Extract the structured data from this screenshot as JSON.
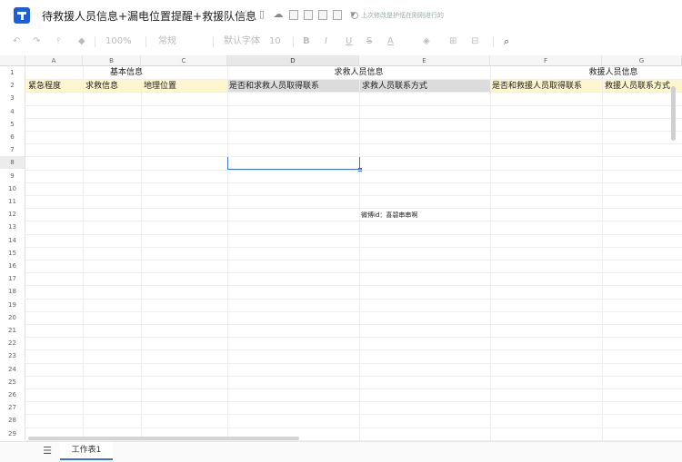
{
  "window": {
    "title": "待救援人员信息+漏电位置提醒+救援队信息",
    "save_status": "上次修改是护恬在刚刚进行的"
  },
  "title_icons": [
    "star-icon",
    "doc-icon",
    "cloud-icon",
    "box-icon",
    "box-icon",
    "box-icon",
    "box-icon",
    "chevron-down-icon"
  ],
  "toolbar": {
    "undo": "↶",
    "redo": "↷",
    "format_painter": "⫯",
    "clear": "◆",
    "zoom": "100%",
    "style": "常规",
    "font": "默认字体",
    "font_size": "10",
    "bold": "B",
    "italic": "I",
    "underline": "U",
    "strike": "S",
    "font_color": "A",
    "fill": "◈",
    "border": "⊞",
    "merge": "⊟",
    "search": "⌕"
  },
  "columns": [
    "A",
    "B",
    "C",
    "D",
    "E",
    "F",
    "G"
  ],
  "rows": [
    "1",
    "2",
    "3",
    "4",
    "5",
    "6",
    "7",
    "8",
    "9",
    "10",
    "11",
    "12",
    "13",
    "14",
    "15",
    "16",
    "17",
    "18",
    "19",
    "20",
    "21",
    "22",
    "23",
    "24",
    "25",
    "26",
    "27",
    "28",
    "29"
  ],
  "sheet": {
    "row1": {
      "basic": "基本信息",
      "seeker": "求救人员信息",
      "rescuer": "救援人员信息"
    },
    "row2": {
      "a": "紧急程度",
      "b": "求救信息",
      "c": "地理位置",
      "d": "是否和求救人员取得联系",
      "e": "求救人员联系方式",
      "f": "是否和救援人员取得联系",
      "g": "救援人员联系方式"
    },
    "e12": "微博id：喜碧串串啊"
  },
  "tabs": {
    "sheet1": "工作表1"
  },
  "colors": {
    "header_fill": "#fdf6cf",
    "selected_header": "#dcdcdc",
    "selection": "#3b73d8"
  }
}
